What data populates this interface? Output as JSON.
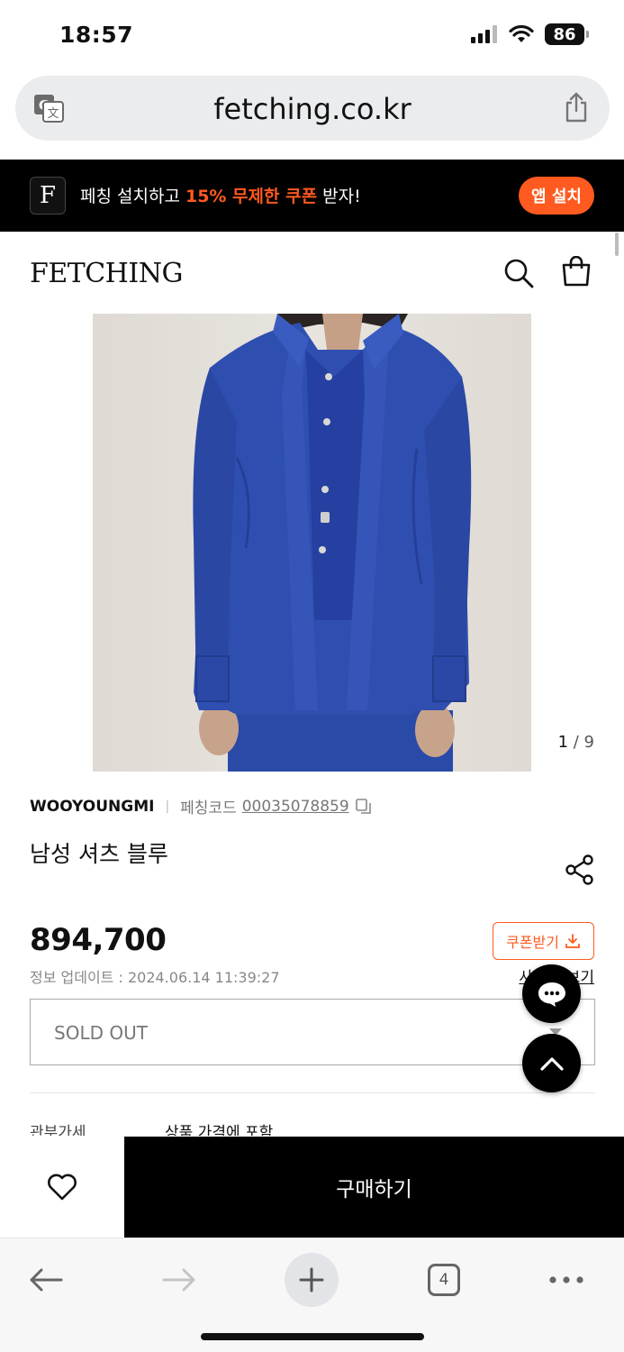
{
  "status_bar": {
    "time": "18:57",
    "battery": "86"
  },
  "browser": {
    "url": "fetching.co.kr",
    "tab_count": "4"
  },
  "promo": {
    "text_before": "페칭 설치하고 ",
    "highlight": "15% 무제한 쿠폰",
    "text_after": " 받자!",
    "logo_letter": "F",
    "button_label": "앱 설치"
  },
  "header": {
    "logo": "FETCHING"
  },
  "product": {
    "image_counter_current": "1",
    "image_counter_total": "/ 9",
    "brand": "WOOYOUNGMI",
    "code_label": "페칭코드",
    "code": "00035078859",
    "title": "남성 셔츠 블루",
    "price": "894,700",
    "info_updated": "정보 업데이트 : 2024.06.14 11:39:27",
    "coupon_label": "쿠폰받기",
    "size_guide": "사이즈 보기",
    "option_value": "SOLD OUT",
    "duty_label": "관부가세",
    "duty_value": "상품 가격에 포함"
  },
  "buy_bar": {
    "buy_label": "구매하기"
  },
  "colors": {
    "accent": "#ff5a1f",
    "black": "#000000",
    "shirt_blue": "#2f4fb0"
  }
}
